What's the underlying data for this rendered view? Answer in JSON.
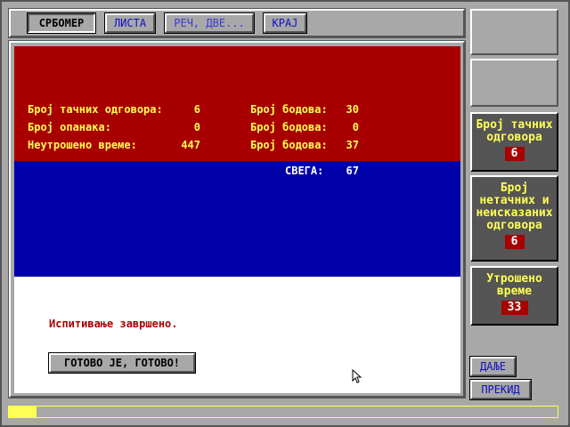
{
  "menu": {
    "srbomer": "СРБОМЕР",
    "lista": "ЛИСТА",
    "rec": "РЕЧ, ДВЕ...",
    "kraj": "КРАЈ"
  },
  "results": {
    "correct_label": "Број тачних одговора:",
    "correct_value": "6",
    "points1_label": "Број бодова:",
    "points1_value": "30",
    "wrong_label": "Број опанака:",
    "wrong_value": "0",
    "points2_label": "Број бодова:",
    "points2_value": "0",
    "time_label": "Неутрошено време:",
    "time_value": "447",
    "points3_label": "Број бодова:",
    "points3_value": "37",
    "total_label": "СВЕГА:",
    "total_value": "67"
  },
  "status": "Испитивање завршено.",
  "done_button": "ГОТОВО ЈЕ, ГОТОВО!",
  "side": {
    "correct_label": "Број тачних одговора",
    "correct_value": "6",
    "wrong_label": "Број нетачних и неисказаних одговора",
    "wrong_value": "6",
    "time_label": "Утрошено време",
    "time_value": "33"
  },
  "buttons": {
    "next": "ДАЉЕ",
    "stop": "ПРЕКИД"
  },
  "progress_percent": 5,
  "colors": {
    "red": "#a80000",
    "blue": "#0000a8",
    "yellow": "#ffff55"
  }
}
